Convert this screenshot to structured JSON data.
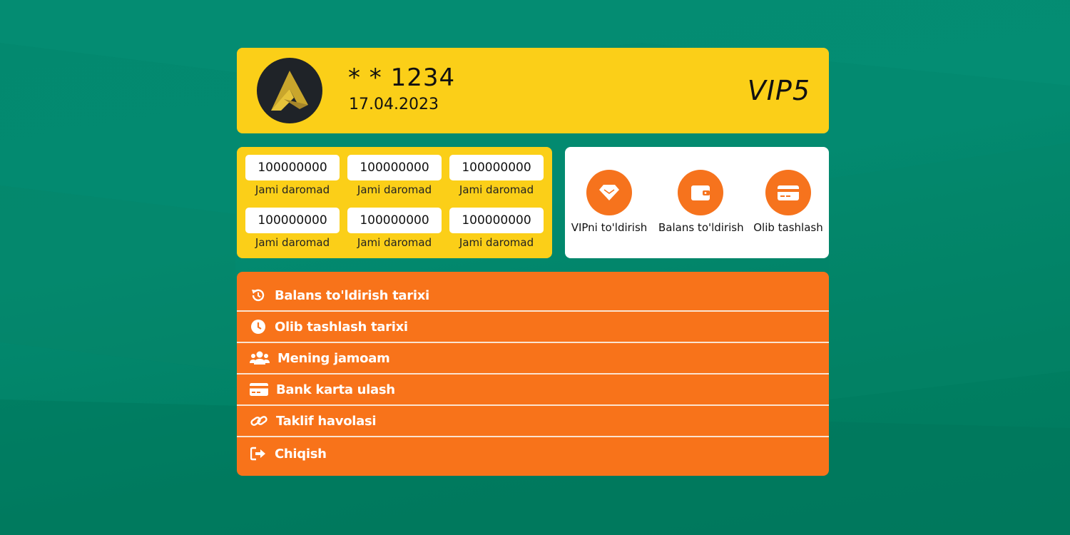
{
  "profile": {
    "username": "* * 1234",
    "date": "17.04.2023",
    "vip_level": "VIP5"
  },
  "stats": [
    {
      "value": "100000000",
      "label": "Jami daromad"
    },
    {
      "value": "100000000",
      "label": "Jami daromad"
    },
    {
      "value": "100000000",
      "label": "Jami daromad"
    },
    {
      "value": "100000000",
      "label": "Jami daromad"
    },
    {
      "value": "100000000",
      "label": "Jami daromad"
    },
    {
      "value": "100000000",
      "label": "Jami daromad"
    }
  ],
  "actions": [
    {
      "label": "VIPni to'ldirish",
      "icon": "diamond-icon"
    },
    {
      "label": "Balans to'ldirish",
      "icon": "wallet-icon"
    },
    {
      "label": "Olib tashlash",
      "icon": "credit-card-icon"
    }
  ],
  "menu": [
    {
      "label": "Balans to'ldirish tarixi",
      "icon": "history-icon"
    },
    {
      "label": "Olib tashlash tarixi",
      "icon": "clock-icon"
    },
    {
      "label": "Mening jamoam",
      "icon": "users-icon"
    },
    {
      "label": "Bank karta ulash",
      "icon": "credit-card-icon"
    },
    {
      "label": "Taklif havolasi",
      "icon": "link-icon"
    },
    {
      "label": "Chiqish",
      "icon": "sign-out-icon"
    }
  ],
  "colors": {
    "background": "#038a70",
    "yellow": "#fbcf18",
    "orange": "#f8731a",
    "white": "#ffffff"
  }
}
